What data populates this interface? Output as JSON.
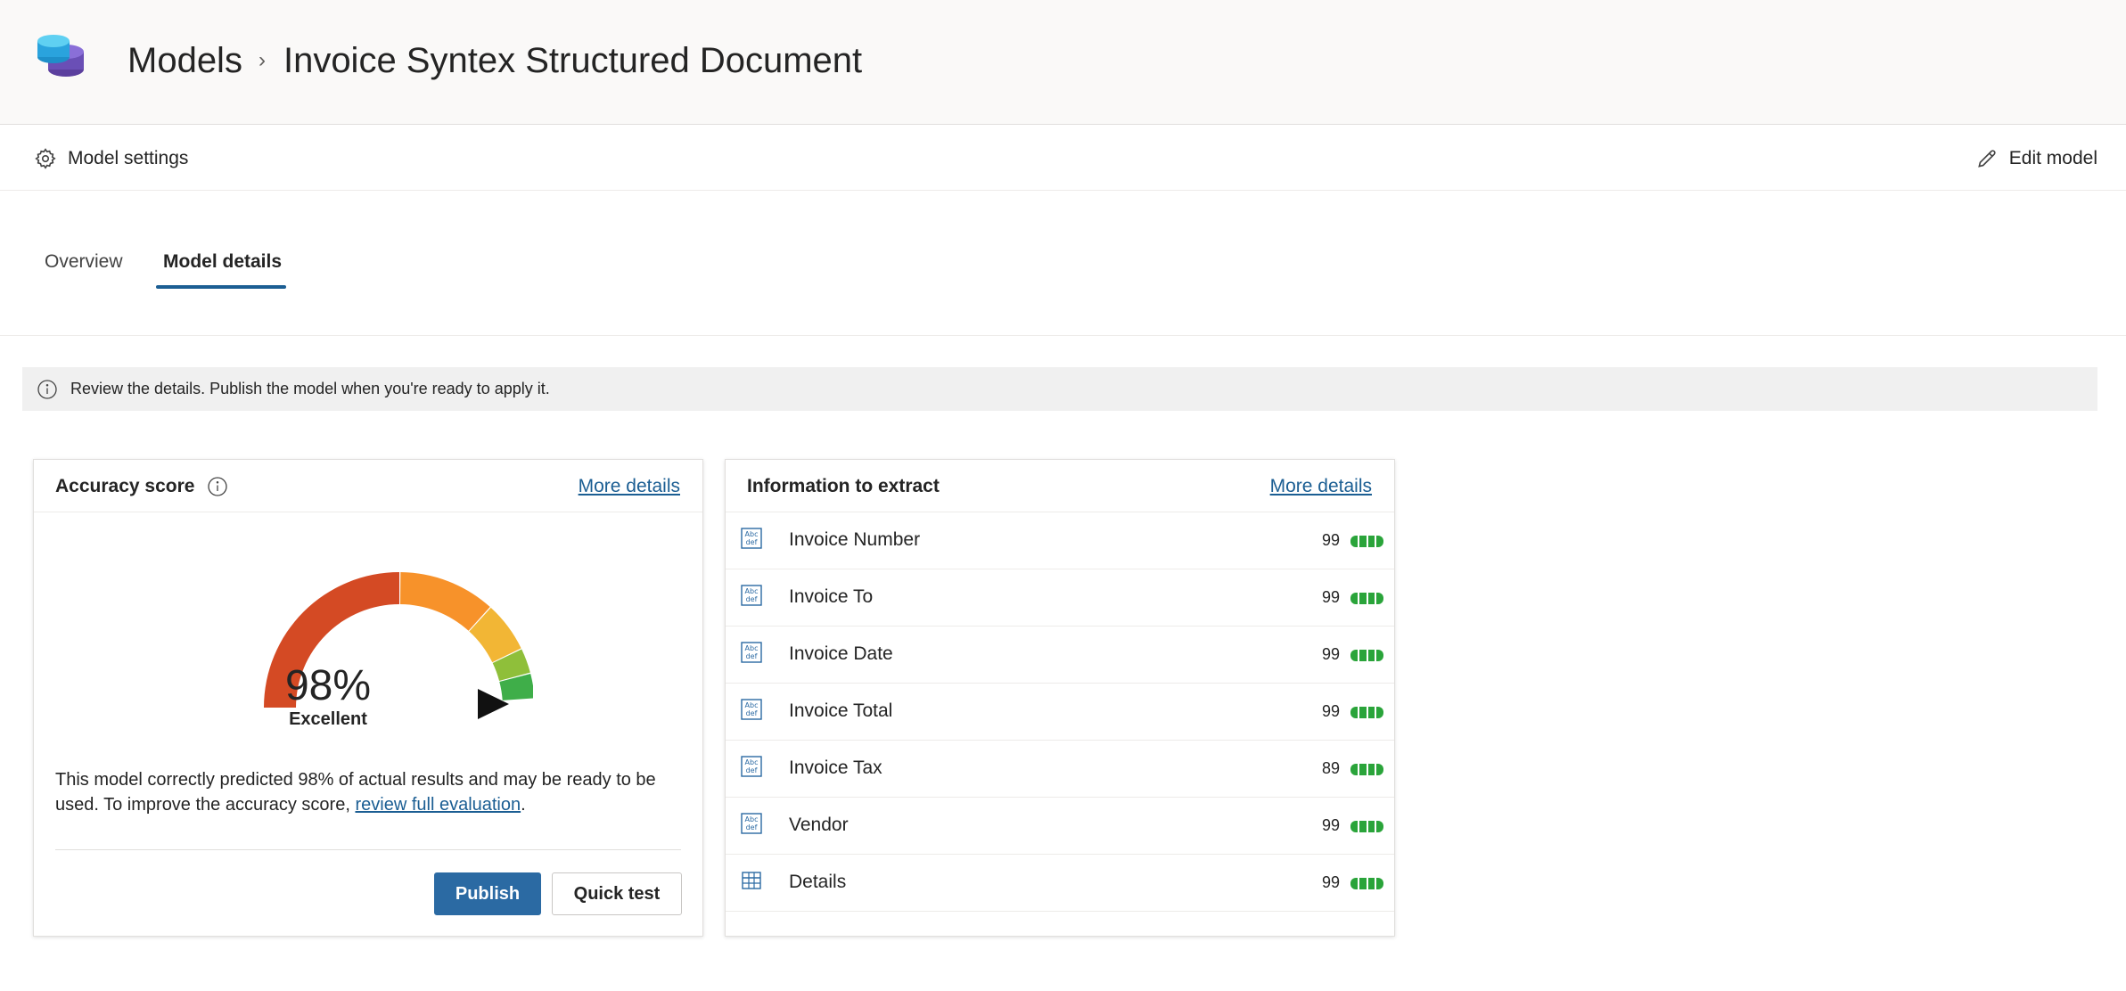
{
  "header": {
    "breadcrumb_root": "Models",
    "breadcrumb_current": "Invoice Syntex Structured Document"
  },
  "commands": {
    "settings_label": "Model settings",
    "edit_label": "Edit model"
  },
  "tabs": [
    {
      "label": "Overview",
      "selected": false
    },
    {
      "label": "Model details",
      "selected": true
    }
  ],
  "info_message": "Review the details. Publish the model when you're ready to apply it.",
  "accuracy_card": {
    "title": "Accuracy score",
    "more_details": "More details",
    "score_text": "98%",
    "score_value": 98,
    "rating": "Excellent",
    "description_prefix": "This model correctly predicted 98% of actual results and may be ready to be used. To improve the accuracy score, ",
    "description_link": "review full evaluation",
    "description_suffix": ".",
    "publish_label": "Publish",
    "quick_test_label": "Quick test",
    "gauge_colors": [
      "#d44a24",
      "#f7922a",
      "#f2b635",
      "#8fbf3a",
      "#3fae49"
    ]
  },
  "extract_card": {
    "title": "Information to extract",
    "more_details": "More details",
    "fields": [
      {
        "name": "Invoice Number",
        "value": "99",
        "icon": "text-field-icon"
      },
      {
        "name": "Invoice To",
        "value": "99",
        "icon": "text-field-icon"
      },
      {
        "name": "Invoice Date",
        "value": "99",
        "icon": "text-field-icon"
      },
      {
        "name": "Invoice Total",
        "value": "99",
        "icon": "text-field-icon"
      },
      {
        "name": "Invoice Tax",
        "value": "89",
        "icon": "text-field-icon"
      },
      {
        "name": "Vendor",
        "value": "99",
        "icon": "text-field-icon"
      },
      {
        "name": "Details",
        "value": "99",
        "icon": "table-icon"
      }
    ]
  }
}
